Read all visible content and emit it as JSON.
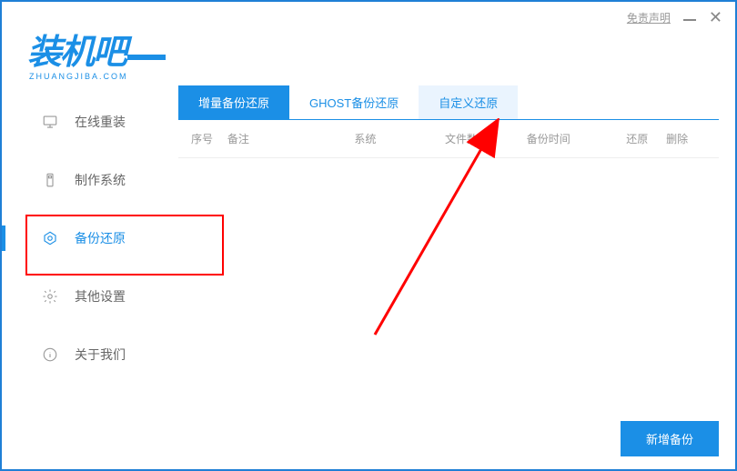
{
  "titlebar": {
    "disclaimer": "免责声明"
  },
  "logo": {
    "text": "装机吧",
    "subtext": "ZHUANGJIBA.COM"
  },
  "sidebar": {
    "items": [
      {
        "label": "在线重装",
        "icon": "monitor-icon"
      },
      {
        "label": "制作系统",
        "icon": "usb-icon"
      },
      {
        "label": "备份还原",
        "icon": "backup-icon"
      },
      {
        "label": "其他设置",
        "icon": "gear-icon"
      },
      {
        "label": "关于我们",
        "icon": "info-icon"
      }
    ],
    "activeIndex": 2
  },
  "tabs": {
    "items": [
      {
        "label": "增量备份还原"
      },
      {
        "label": "GHOST备份还原"
      },
      {
        "label": "自定义还原"
      }
    ],
    "activeIndex": 0,
    "hoverIndex": 2
  },
  "table": {
    "cols": {
      "index": "序号",
      "remark": "备注",
      "system": "系统",
      "filecount": "文件数量",
      "time": "备份时间",
      "restore": "还原",
      "delete": "删除"
    }
  },
  "actions": {
    "newBackup": "新增备份"
  }
}
